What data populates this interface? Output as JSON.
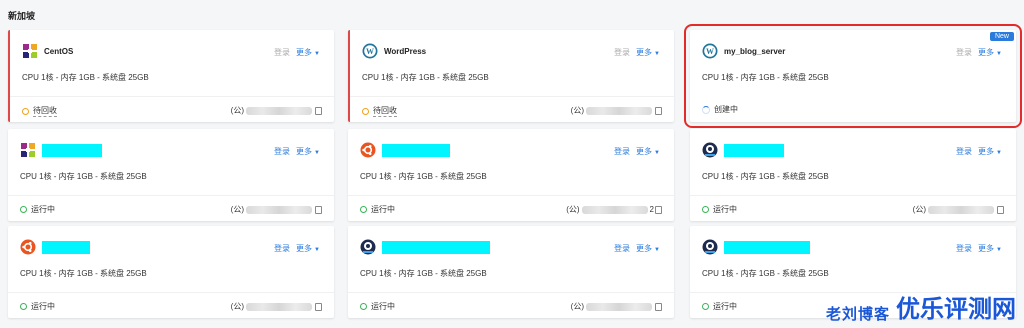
{
  "heading": "新加坡",
  "actions": {
    "login": "登录",
    "more": "更多"
  },
  "spec": "CPU 1核 - 内存 1GB - 系统盘 25GB",
  "ip_prefix": "(公)",
  "statuses": {
    "pending": "待回收",
    "creating": "创建中",
    "running": "运行中"
  },
  "cards": [
    {
      "name": "CentOS",
      "status": "待回收"
    },
    {
      "name": "WordPress",
      "status": "待回收"
    },
    {
      "name": "my_blog_server",
      "status": "创建中",
      "badge": "New"
    },
    {
      "name": "",
      "status": "运行中"
    },
    {
      "name": "",
      "status": "运行中"
    },
    {
      "name": "",
      "status": "运行中"
    },
    {
      "name": "",
      "status": "运行中"
    },
    {
      "name": "",
      "status": "运行中"
    },
    {
      "name": "",
      "status": "运行中"
    }
  ],
  "ip_suffix_card5": "2",
  "watermark": {
    "left": "老刘博客",
    "right": "优乐评测网"
  },
  "colors": {
    "accent": "#2b7bdc",
    "alert": "#e04848",
    "running": "#3cb35a",
    "pending": "#f0a020",
    "redact": "#00f5ff"
  }
}
